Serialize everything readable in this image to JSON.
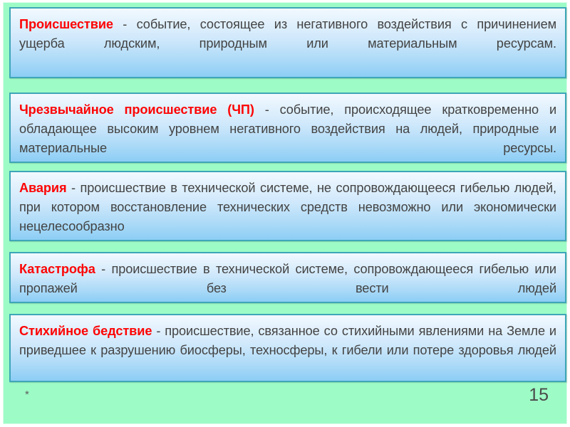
{
  "slide": {
    "background_color": "#9dfbc6",
    "box_border_color": "#3ea6b8",
    "term_color": "#fc0404",
    "body_text_color": "#434343",
    "definitions": [
      {
        "term": "Происшествие",
        "dash": " - ",
        "body": "событие, состоящее из негативного воздействия с причинением ущерба людским, природным или материальным ресурсам."
      },
      {
        "term": "Чрезвычайное происшествие (ЧП)",
        "dash": " - ",
        "body": "событие, происходящее кратковременно и обладающее высоким уровнем негативного воздействия на людей, природные и материальные ресурсы."
      },
      {
        "term": "Авария",
        "dash": " - ",
        "body": "происшествие в технической системе, не сопровождающееся гибелью людей, при котором восстановление технических средств невозможно или экономически нецелесообразно"
      },
      {
        "term": "Катастрофа",
        "dash": " - ",
        "body": "происшествие в технической системе, сопровождающееся гибелью или пропажей без вести людей"
      },
      {
        "term": "Стихийное бедствие",
        "dash": " - ",
        "body": "происшествие, связанное со стихийными явлениями на Земле и приведшее к разрушению биосферы, техносферы, к гибели или потере здоровья людей"
      }
    ],
    "footer": {
      "asterisk": "*",
      "page_number": "15"
    }
  }
}
